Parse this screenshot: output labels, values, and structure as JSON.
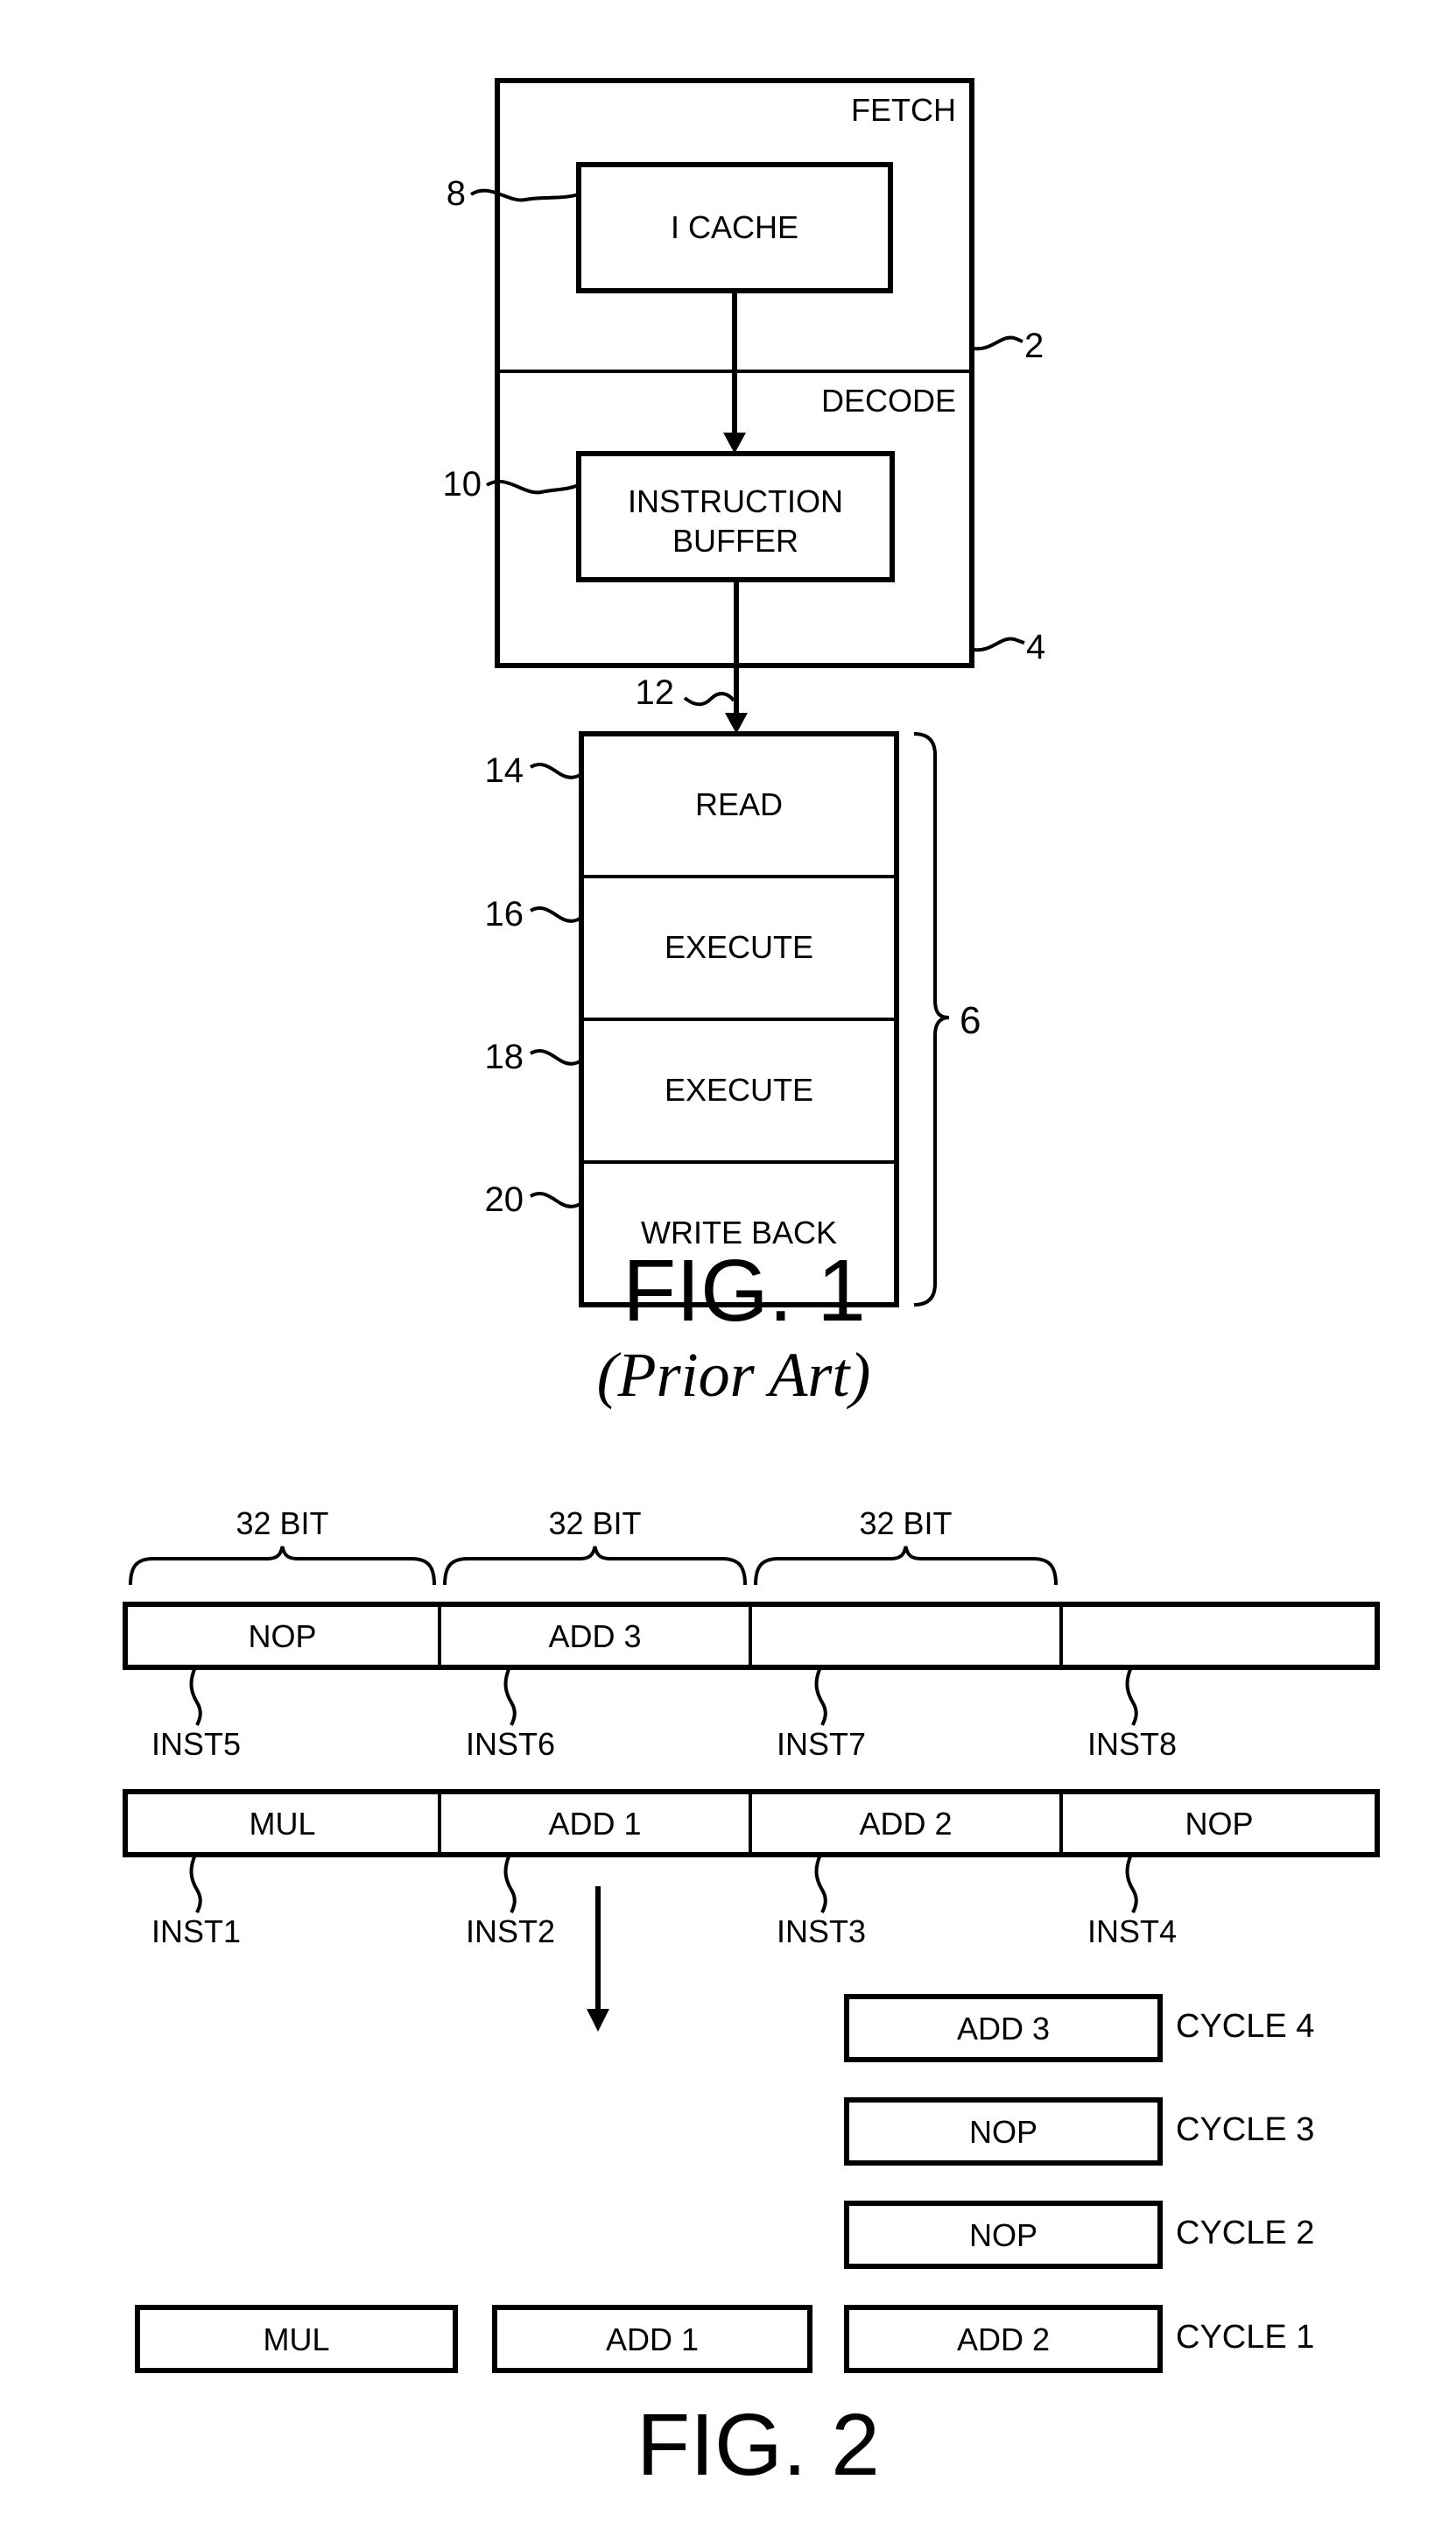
{
  "fig1": {
    "stage_labels": {
      "fetch": "FETCH",
      "decode": "DECODE"
    },
    "blocks": {
      "icache": "I CACHE",
      "instruction_buffer_line1": "INSTRUCTION",
      "instruction_buffer_line2": "BUFFER"
    },
    "pipeline": [
      "READ",
      "EXECUTE",
      "EXECUTE",
      "WRITE BACK"
    ],
    "refs": {
      "fetch_stage": "2",
      "decode_stage": "4",
      "pipeline_group": "6",
      "icache": "8",
      "instruction_buffer": "10",
      "issue_path": "12",
      "read": "14",
      "execute1": "16",
      "execute2": "18",
      "write_back": "20"
    },
    "caption": "FIG. 1",
    "subcaption": "(Prior Art)"
  },
  "fig2": {
    "width_labels": [
      "32 BIT",
      "32 BIT",
      "32 BIT"
    ],
    "upper_row": {
      "cells": [
        "NOP",
        "ADD 3",
        "",
        ""
      ],
      "inst_labels": [
        "INST5",
        "INST6",
        "INST7",
        "INST8"
      ]
    },
    "lower_row": {
      "cells": [
        "MUL",
        "ADD 1",
        "ADD 2",
        "NOP"
      ],
      "inst_labels": [
        "INST1",
        "INST2",
        "INST3",
        "INST4"
      ]
    },
    "issue": {
      "slot1": [
        "MUL"
      ],
      "slot2": [
        "ADD 1"
      ],
      "slot3": [
        "ADD 2",
        "NOP",
        "NOP",
        "ADD 3"
      ],
      "cycle_labels": [
        "CYCLE 1",
        "CYCLE 2",
        "CYCLE 3",
        "CYCLE 4"
      ]
    },
    "caption": "FIG. 2"
  }
}
